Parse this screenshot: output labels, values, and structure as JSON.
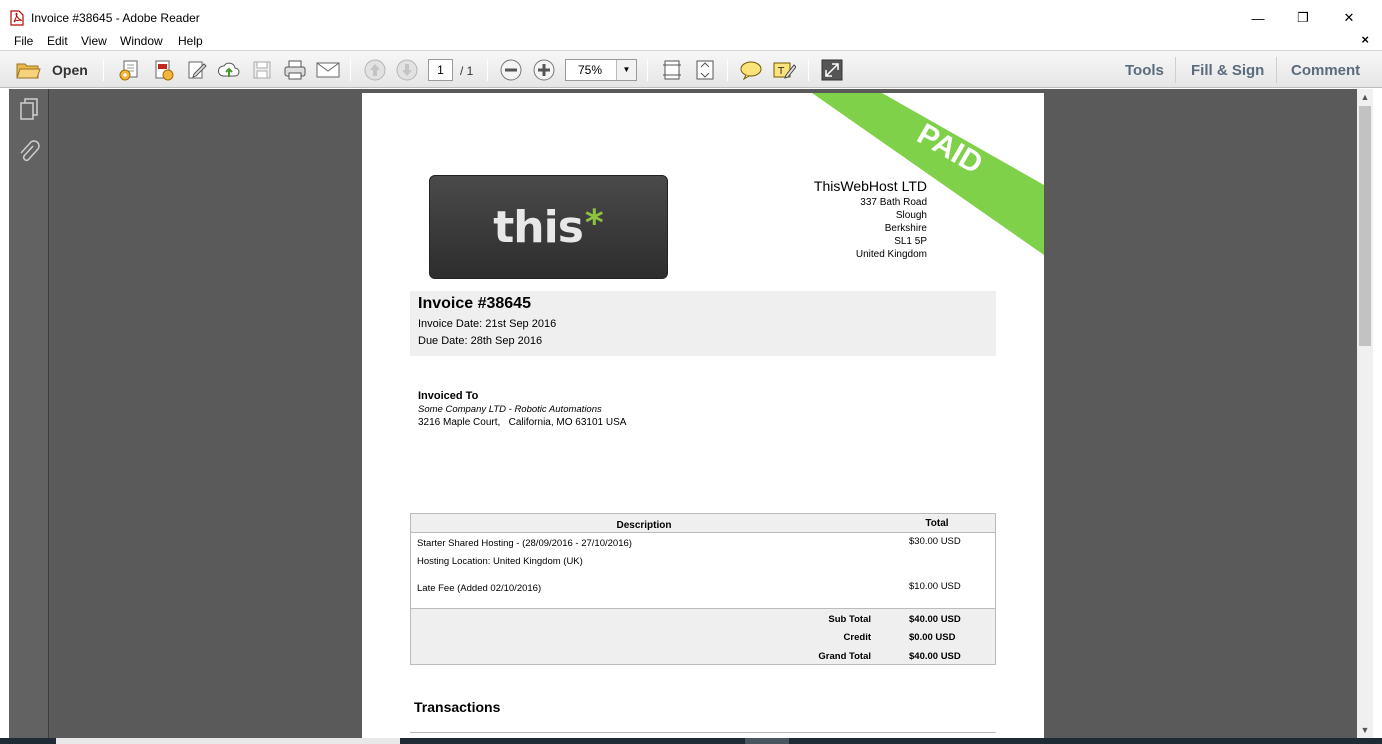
{
  "window": {
    "title": "Invoice #38645 - Adobe Reader",
    "minimize_glyph": "—",
    "restore_glyph": "❐",
    "close_glyph": "✕"
  },
  "menu": {
    "items": [
      "File",
      "Edit",
      "View",
      "Window",
      "Help"
    ],
    "close_glyph": "×"
  },
  "toolbar": {
    "open_label": "Open",
    "page_current": "1",
    "page_total": "/ 1",
    "zoom": "75%",
    "panels": [
      "Tools",
      "Fill & Sign",
      "Comment"
    ],
    "icons": [
      "folder-open-icon",
      "create-pdf-icon",
      "export-pdf-icon",
      "edit-pdf-icon",
      "cloud-upload-icon",
      "save-icon",
      "print-icon",
      "email-icon",
      "prev-page-icon",
      "next-page-icon",
      "zoom-out-icon",
      "zoom-in-icon",
      "fit-width-icon",
      "fit-page-icon",
      "comment-icon",
      "highlight-icon",
      "full-screen-icon"
    ]
  },
  "navpane": {
    "icons": [
      "pages-icon",
      "attachment-icon"
    ]
  },
  "invoice": {
    "stamp": "PAID",
    "logo_text": "this",
    "logo_star": "*",
    "company": {
      "name": "ThisWebHost LTD",
      "address": [
        "337 Bath Road",
        "Slough",
        "Berkshire",
        "SL1 5P",
        "United Kingdom"
      ]
    },
    "title": "Invoice #38645",
    "invoice_date": "Invoice Date: 21st Sep 2016",
    "due_date": "Due Date: 28th Sep 2016",
    "bill_to": {
      "label": "Invoiced To",
      "company": "Some Company LTD - Robotic Automations",
      "address": "3216 Maple Court,   California, MO 63101 USA"
    },
    "items_table": {
      "headers": [
        "Description",
        "Total"
      ],
      "rows": [
        {
          "description": "Starter Shared Hosting - (28/09/2016 - 27/10/2016)",
          "total": "$30.00 USD"
        },
        {
          "description": "Hosting Location: United Kingdom (UK)",
          "total": ""
        },
        {
          "description": "Late Fee (Added 02/10/2016)",
          "total": "$10.00 USD"
        }
      ],
      "totals": [
        {
          "label": "Sub Total",
          "value": "$40.00 USD"
        },
        {
          "label": "Credit",
          "value": "$0.00 USD"
        },
        {
          "label": "Grand Total",
          "value": "$40.00 USD"
        }
      ]
    },
    "transactions_title": "Transactions"
  },
  "colors": {
    "paid_green": "#7fd14a",
    "logo_star": "#8cc43f",
    "doc_background": "#5a5a5a",
    "panel_link": "#5b6b7b"
  }
}
